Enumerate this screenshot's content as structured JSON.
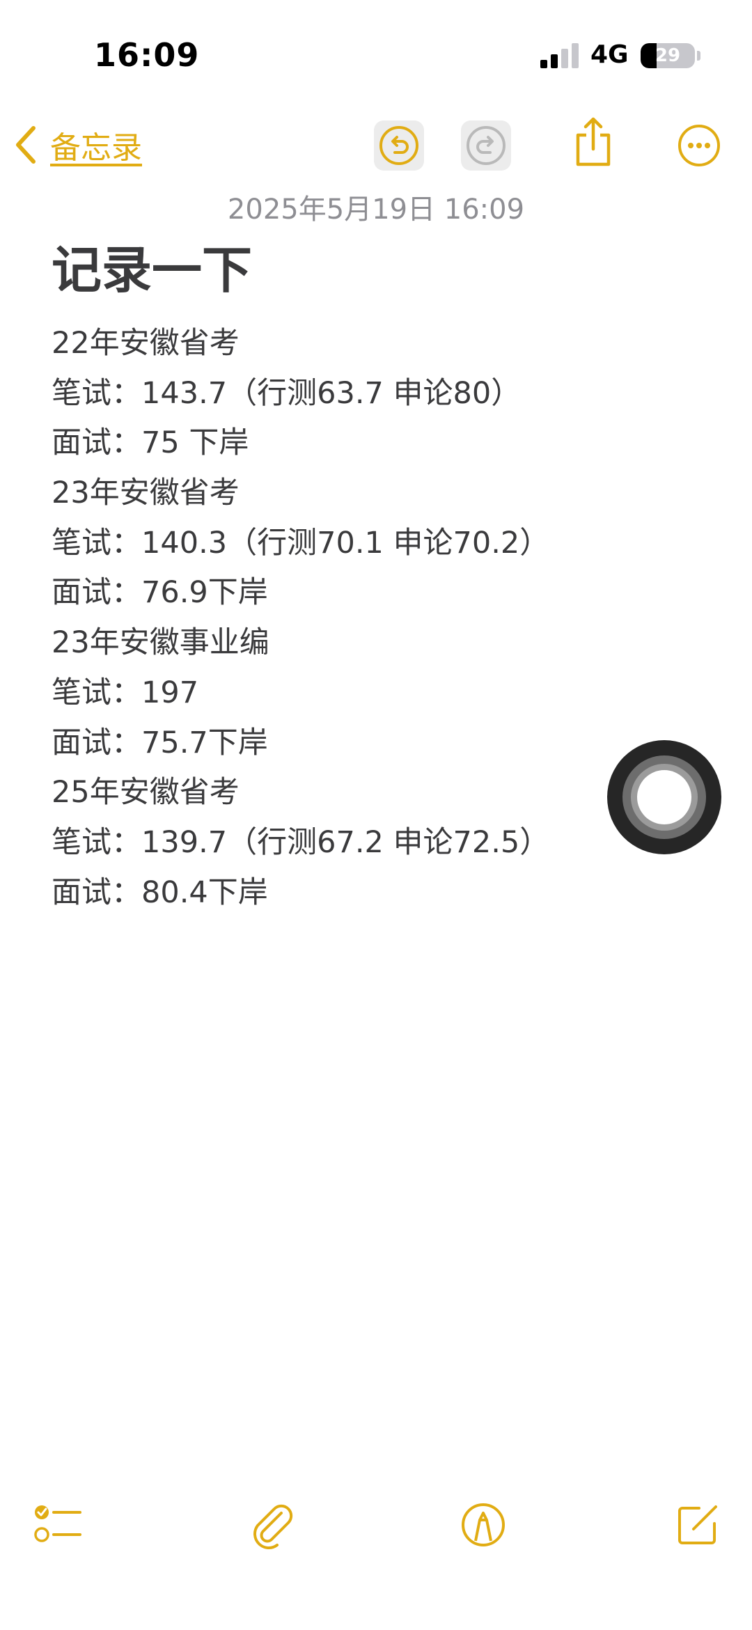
{
  "status_bar": {
    "time": "16:09",
    "network": "4G",
    "battery_level": "29",
    "battery_fraction": 0.29,
    "signal_bars_active": 2,
    "signal_bars_total": 4
  },
  "nav": {
    "back_label": "备忘录",
    "icons": {
      "back": "chevron-left-icon",
      "undo": "undo-icon",
      "redo": "redo-icon",
      "share": "share-icon",
      "more": "more-icon"
    }
  },
  "note": {
    "date": "2025年5月19日 16:09",
    "title": "记录一下",
    "lines": [
      "22年安徽省考",
      "笔试：143.7（行测63.7  申论80）",
      "面试：75 下岸",
      "23年安徽省考",
      "笔试：140.3（行测70.1  申论70.2）",
      "面试：76.9下岸",
      "23年安徽事业编",
      "笔试：197",
      "面试：75.7下岸",
      "25年安徽省考",
      "笔试：139.7（行测67.2  申论72.5）",
      "面试：80.4下岸"
    ]
  },
  "toolbar": {
    "icons": {
      "checklist": "checklist-icon",
      "attachment": "paperclip-icon",
      "markup": "markup-pen-icon",
      "compose": "compose-icon"
    }
  },
  "colors": {
    "accent": "#e1ac13",
    "text": "#3a3a3c",
    "date": "#8e8e93",
    "disabled_icon": "#b9b9b9"
  }
}
